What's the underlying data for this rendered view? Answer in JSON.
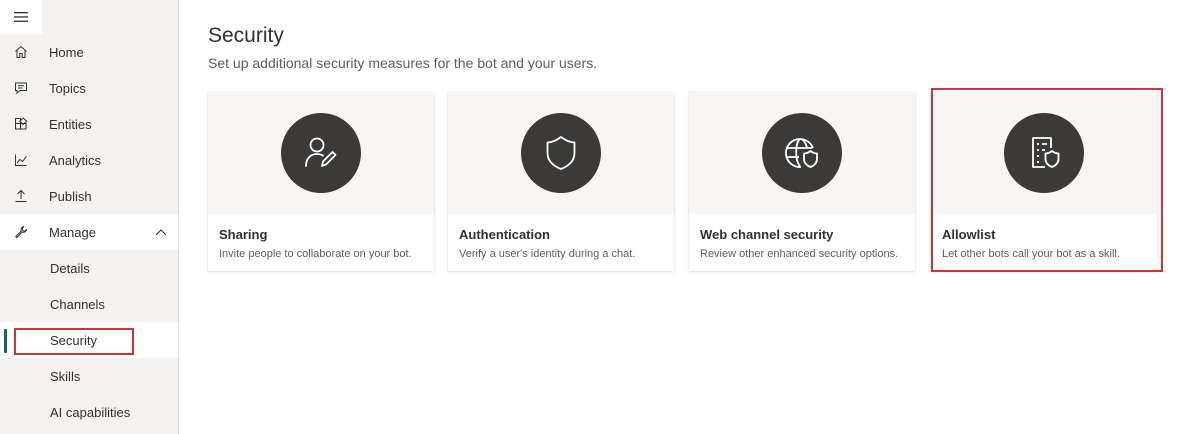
{
  "sidebar": {
    "items": [
      {
        "label": "Home",
        "icon": "home-icon"
      },
      {
        "label": "Topics",
        "icon": "chat-icon"
      },
      {
        "label": "Entities",
        "icon": "entities-icon"
      },
      {
        "label": "Analytics",
        "icon": "analytics-icon"
      },
      {
        "label": "Publish",
        "icon": "publish-icon"
      },
      {
        "label": "Manage",
        "icon": "wrench-icon",
        "expanded": true
      }
    ],
    "sub_items": [
      {
        "label": "Details"
      },
      {
        "label": "Channels"
      },
      {
        "label": "Security",
        "active": true
      },
      {
        "label": "Skills"
      },
      {
        "label": "AI capabilities"
      }
    ]
  },
  "main": {
    "title": "Security",
    "subtitle": "Set up additional security measures for the bot and your users.",
    "cards": [
      {
        "title": "Sharing",
        "description": "Invite people to collaborate on your bot.",
        "icon": "person-edit-icon"
      },
      {
        "title": "Authentication",
        "description": "Verify a user's identity during a chat.",
        "icon": "shield-icon"
      },
      {
        "title": "Web channel security",
        "description": "Review other enhanced security options.",
        "icon": "globe-shield-icon"
      },
      {
        "title": "Allowlist",
        "description": "Let other bots call your bot as a skill.",
        "icon": "list-shield-icon",
        "highlighted": true
      }
    ]
  },
  "colors": {
    "sidebar_bg": "#f3f2f1",
    "active_indicator": "#0b6a59",
    "highlight": "#d13438",
    "icon_circle": "#3b3a39"
  }
}
